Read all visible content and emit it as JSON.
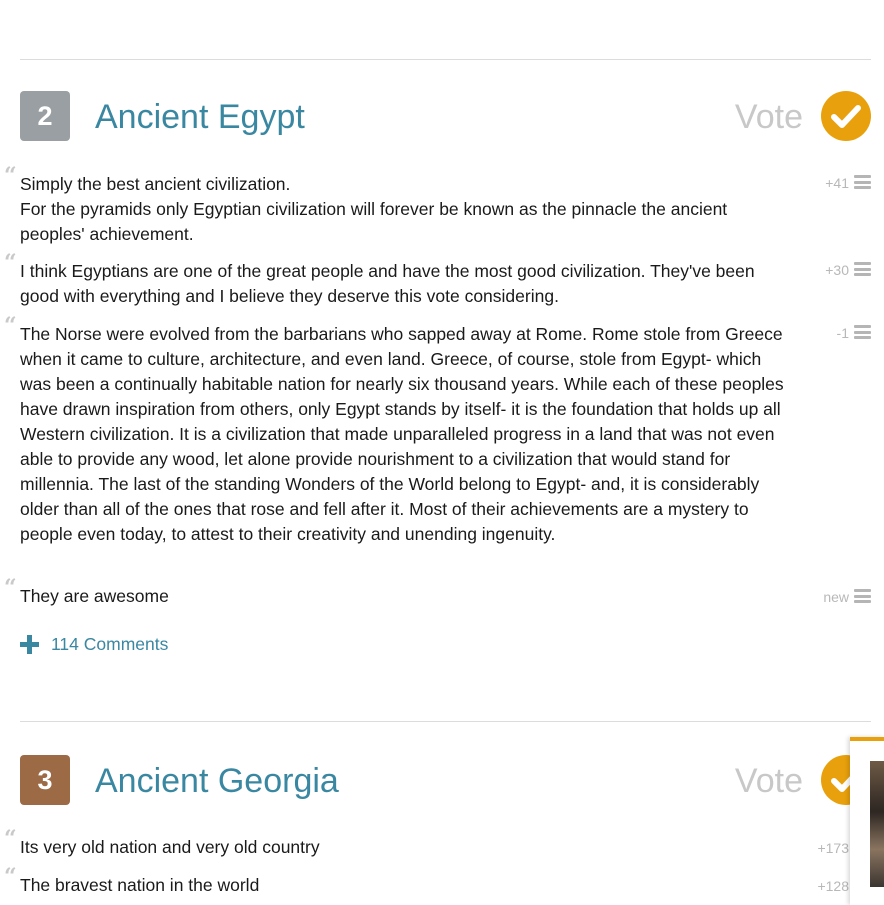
{
  "colors": {
    "accent_blue": "#3a87a2",
    "vote_orange": "#e8a10c",
    "rank2_gray": "#9a9fa3",
    "rank3_brown": "#9c6a45"
  },
  "items": [
    {
      "rank": "2",
      "title": "Ancient Egypt",
      "vote_label": "Vote",
      "comments": [
        {
          "text": "Simply the best ancient civilization.\nFor the pyramids only Egyptian civilization will forever be known as the pinnacle the ancient peoples' achievement.",
          "score": "+41"
        },
        {
          "text": "I think Egyptians are one of the great people and have the most good civilization. They've been good with everything and I believe they deserve this vote considering.",
          "score": "+30"
        },
        {
          "text": "The Norse were evolved from the barbarians who sapped away at Rome. Rome stole from Greece when it came to culture, architecture, and even land. Greece, of course, stole from Egypt- which was been a continually habitable nation for nearly six thousand years. While each of these peoples have drawn inspiration from others, only Egypt stands by itself- it is the foundation that holds up all Western civilization. It is a civilization that made unparalleled progress in a land that was not even able to provide any wood, let alone provide nourishment to a civilization that would stand for millennia. The last of the standing Wonders of the World belong to Egypt- and, it is considerably older than all of the ones that rose and fell after it. Most of their achievements are a mystery to people even today, to attest to their creativity and unending ingenuity.",
          "score": "-1"
        },
        {
          "text": "They are awesome",
          "score": "new"
        }
      ],
      "more_comments": "114 Comments"
    },
    {
      "rank": "3",
      "title": "Ancient Georgia",
      "vote_label": "Vote",
      "comments": [
        {
          "text": "Its very old nation and very old country",
          "score": "+173"
        },
        {
          "text": "The bravest nation in the world",
          "score": "+128"
        }
      ]
    }
  ]
}
